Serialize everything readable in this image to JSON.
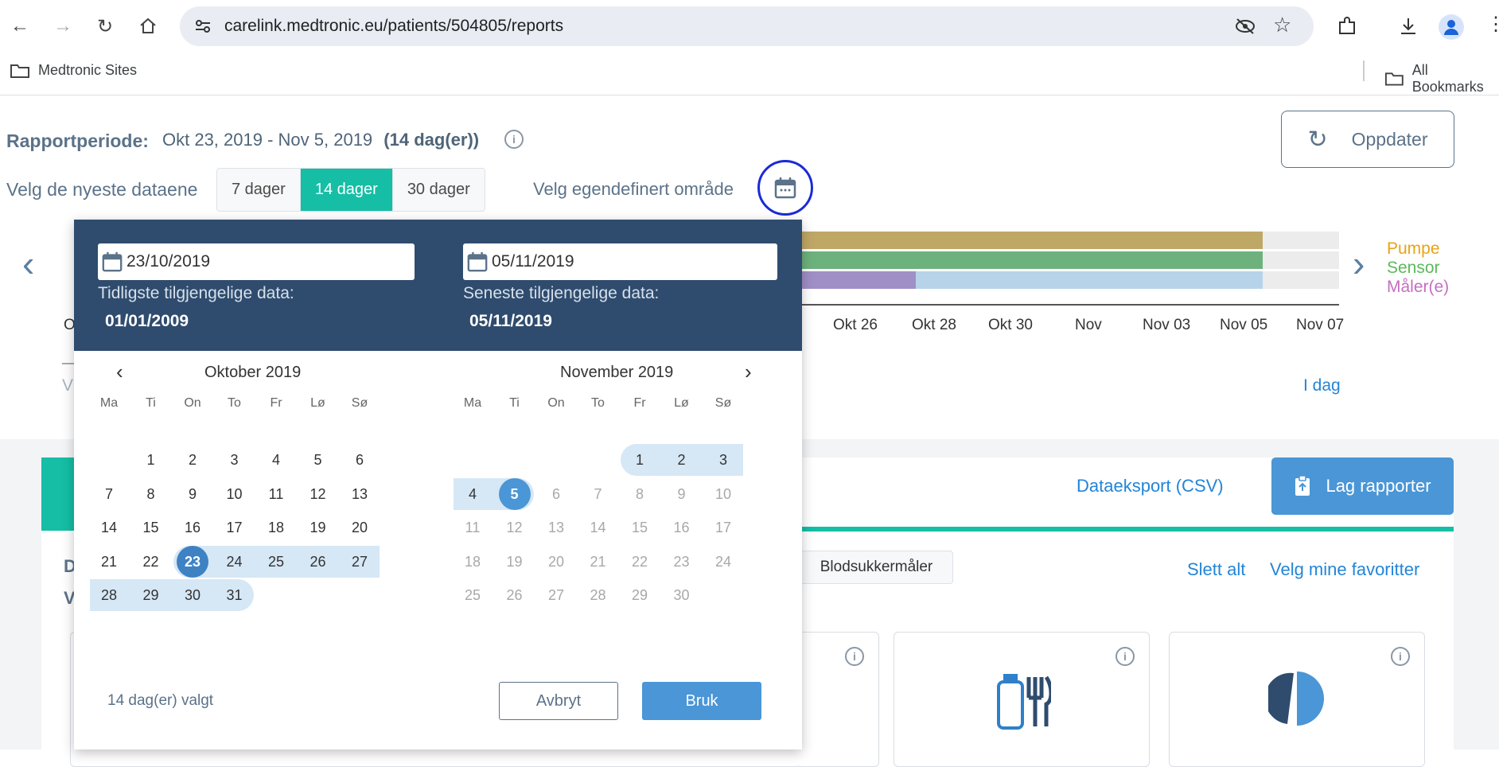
{
  "browser": {
    "url": "carelink.medtronic.eu/patients/504805/reports",
    "bookmark_left": "Medtronic Sites",
    "bookmark_right": "All Bookmarks"
  },
  "header": {
    "period_label": "Rapportperiode:",
    "period_range": "Okt 23, 2019 - Nov 5, 2019",
    "period_days": "(14 dag(er))",
    "refresh_label": "Oppdater",
    "newest_label": "Velg de nyeste dataene",
    "seg_7": "7 dager",
    "seg_14": "14 dager",
    "seg_30": "30 dager",
    "custom_label": "Velg egendefinert område"
  },
  "timeline": {
    "legend": [
      "Pumpe",
      "Sensor",
      "Måler(e)"
    ],
    "legend_colors": [
      "#e8a317",
      "#5cb85c",
      "#c46fc0"
    ],
    "axis_labels": [
      "Okt 26",
      "Okt 28",
      "Okt 30",
      "Nov",
      "Nov 03",
      "Nov 05",
      "Nov 07"
    ],
    "axis_stub": "O",
    "today_link": "I dag",
    "stub_v": "V"
  },
  "lower": {
    "csv_link": "Dataeksport (CSV)",
    "report_button": "Lag rapporter",
    "chip": "Blodsukkermåler",
    "clear_all": "Slett alt",
    "favorites": "Velg mine favoritter",
    "stub_d": "D",
    "stub_v": "V"
  },
  "datepicker": {
    "start_value": "23/10/2019",
    "end_value": "05/11/2019",
    "earliest_label": "Tidligste tilgjengelige data:",
    "earliest_value": "01/01/2009",
    "latest_label": "Seneste tilgjengelige data:",
    "latest_value": "05/11/2019",
    "left_month": "Oktober 2019",
    "right_month": "November 2019",
    "weekdays": [
      "Ma",
      "Ti",
      "On",
      "To",
      "Fr",
      "Lø",
      "Sø"
    ],
    "selected_summary": "14 dag(er) valgt",
    "cancel": "Avbryt",
    "apply": "Bruk"
  }
}
